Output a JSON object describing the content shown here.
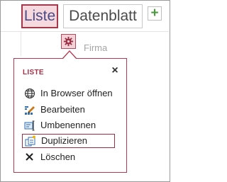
{
  "tabs": [
    {
      "label": "Liste"
    },
    {
      "label": "Datenblatt"
    }
  ],
  "add_button": {
    "label": "+"
  },
  "field": {
    "label": "Firma"
  },
  "popup": {
    "title": "LISTE",
    "close_label": "×",
    "items": [
      {
        "label": "In Browser öffnen",
        "icon": "globe-icon"
      },
      {
        "label": "Bearbeiten",
        "icon": "edit-icon"
      },
      {
        "label": "Umbenennen",
        "icon": "rename-icon"
      },
      {
        "label": "Duplizieren",
        "icon": "duplicate-icon"
      },
      {
        "label": "Löschen",
        "icon": "delete-icon"
      }
    ]
  },
  "colors": {
    "accent": "#a62f44",
    "selected_tab_bg": "#f5d9de",
    "add_green": "#4a9a3e"
  }
}
